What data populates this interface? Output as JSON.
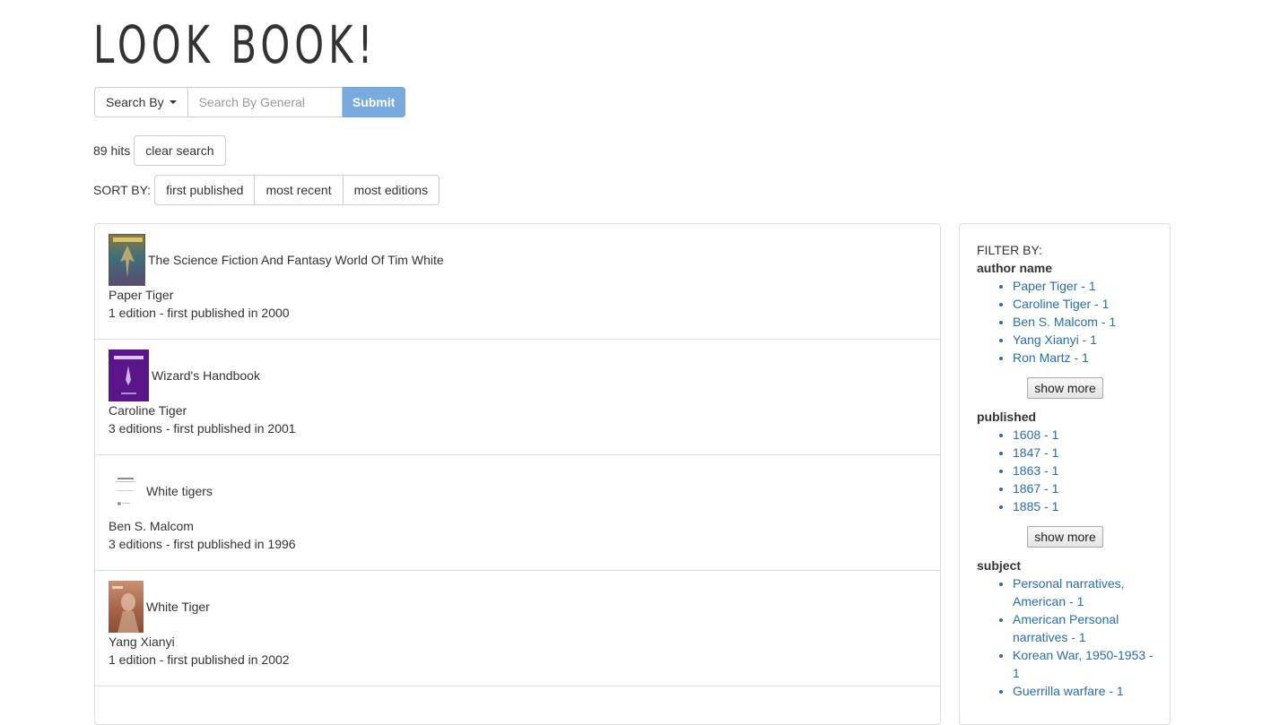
{
  "site": {
    "title": "LOOK BOOK!"
  },
  "search": {
    "search_by_label": "Search By",
    "placeholder": "Search By General",
    "submit_label": "Submit"
  },
  "hits": {
    "text": "89 hits",
    "clear_label": "clear search"
  },
  "sort": {
    "label": "SORT BY:",
    "options": [
      "first published",
      "most recent",
      "most editions"
    ]
  },
  "results": [
    {
      "title": "The Science Fiction And Fantasy World Of Tim White",
      "author": "Paper Tiger",
      "meta": "1 edition - first published in 2000"
    },
    {
      "title": "Wizard's Handbook",
      "author": "Caroline Tiger",
      "meta": "3 editions - first published in 2001"
    },
    {
      "title": "White tigers",
      "author": "Ben S. Malcom",
      "meta": "3 editions - first published in 1996"
    },
    {
      "title": "White Tiger",
      "author": "Yang Xianyi",
      "meta": "1 edition - first published in 2002"
    }
  ],
  "filters": {
    "label": "FILTER BY:",
    "show_more_label": "show more",
    "author": {
      "heading": "author name",
      "items": [
        "Paper Tiger - 1",
        "Caroline Tiger - 1",
        "Ben S. Malcom - 1",
        "Yang Xianyi - 1",
        "Ron Martz - 1"
      ]
    },
    "published": {
      "heading": "published",
      "items": [
        "1608 - 1",
        "1847 - 1",
        "1863 - 1",
        "1867 - 1",
        "1885 - 1"
      ]
    },
    "subject": {
      "heading": "subject",
      "items": [
        "Personal narratives, American - 1",
        "American Personal narratives - 1",
        "Korean War, 1950-1953 - 1",
        "Guerrilla warfare - 1"
      ]
    }
  }
}
